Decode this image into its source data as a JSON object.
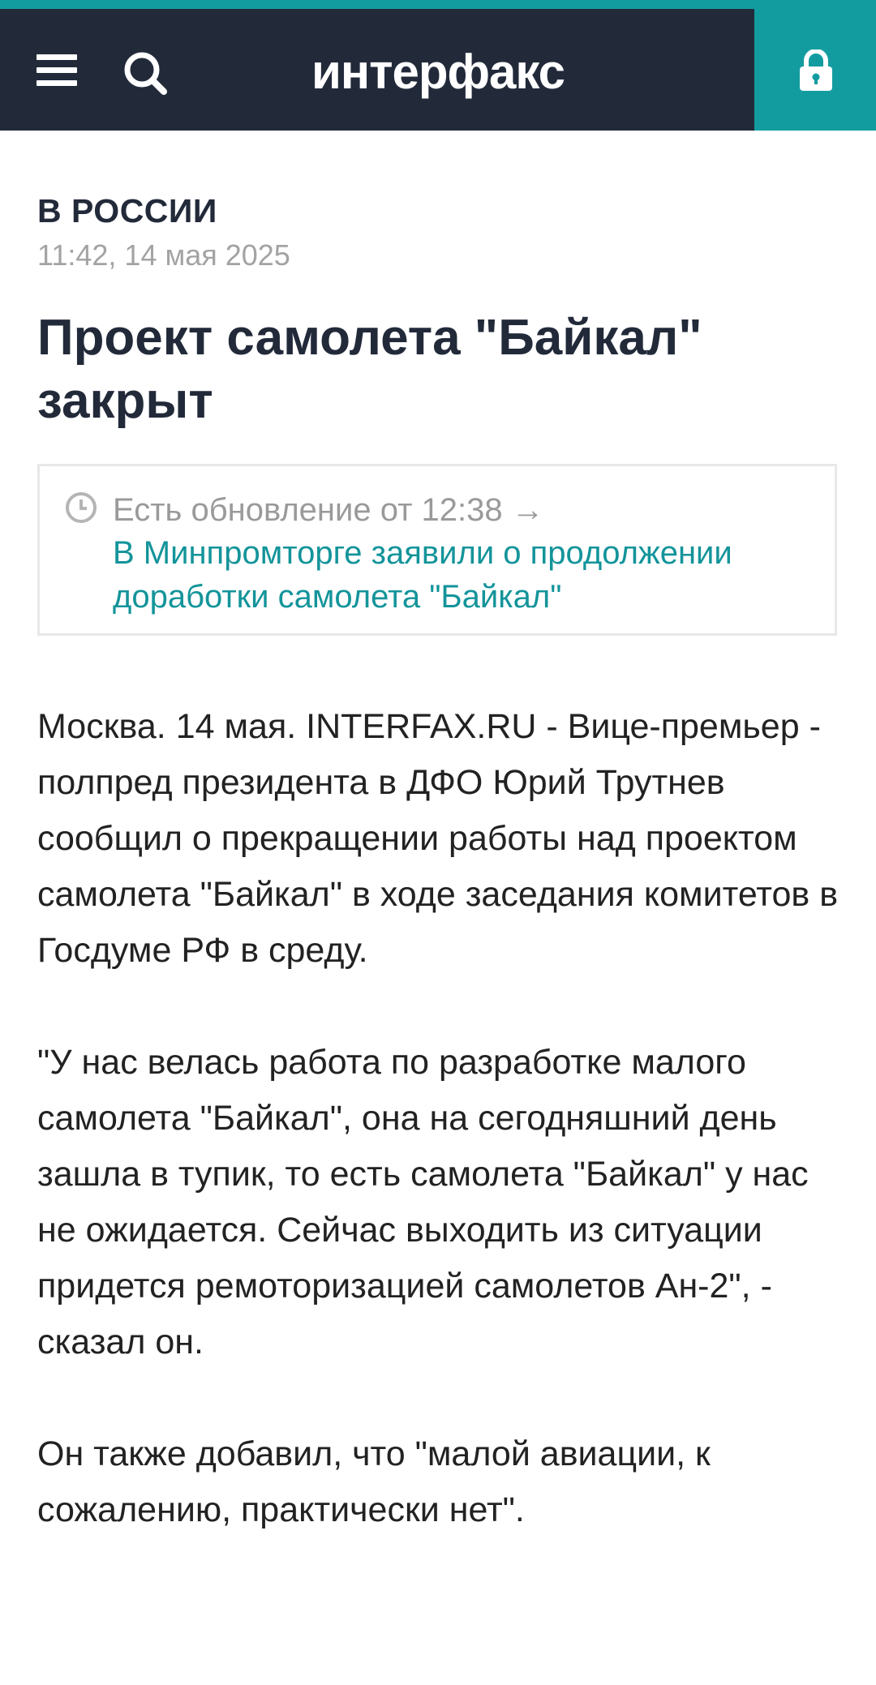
{
  "header": {
    "logo_text": "интерфакс",
    "menu_icon": "hamburger-menu-icon",
    "search_icon": "search-icon",
    "lock_icon": "lock-icon"
  },
  "colors": {
    "header_bg": "#222a3a",
    "accent": "#139ca0",
    "link": "#13949a",
    "muted": "#a3a3a3"
  },
  "article": {
    "section": "В РОССИИ",
    "timestamp": "11:42, 14 мая 2025",
    "title": "Проект самолета \"Байкал\" закрыт",
    "update": {
      "label": "Есть обновление от 12:38 →",
      "link_text": "В Минпромторге заявили о продолжении доработки самолета \"Байкал\""
    },
    "paragraphs": [
      "Москва. 14 мая. INTERFAX.RU - Вице-премьер - полпред президента в ДФО Юрий Трутнев сообщил о прекращении работы над проектом самолета \"Байкал\" в ходе заседания комитетов в Госдуме РФ в среду.",
      "\"У нас велась работа по разработке малого самолета \"Байкал\", она на сегодняшний день зашла в тупик, то есть самолета \"Байкал\" у нас не ожидается. Сейчас выходить из ситуации придется ремоторизацией самолетов Ан-2\", - сказал он.",
      "Он также добавил, что \"малой авиации, к сожалению, практически нет\"."
    ]
  }
}
